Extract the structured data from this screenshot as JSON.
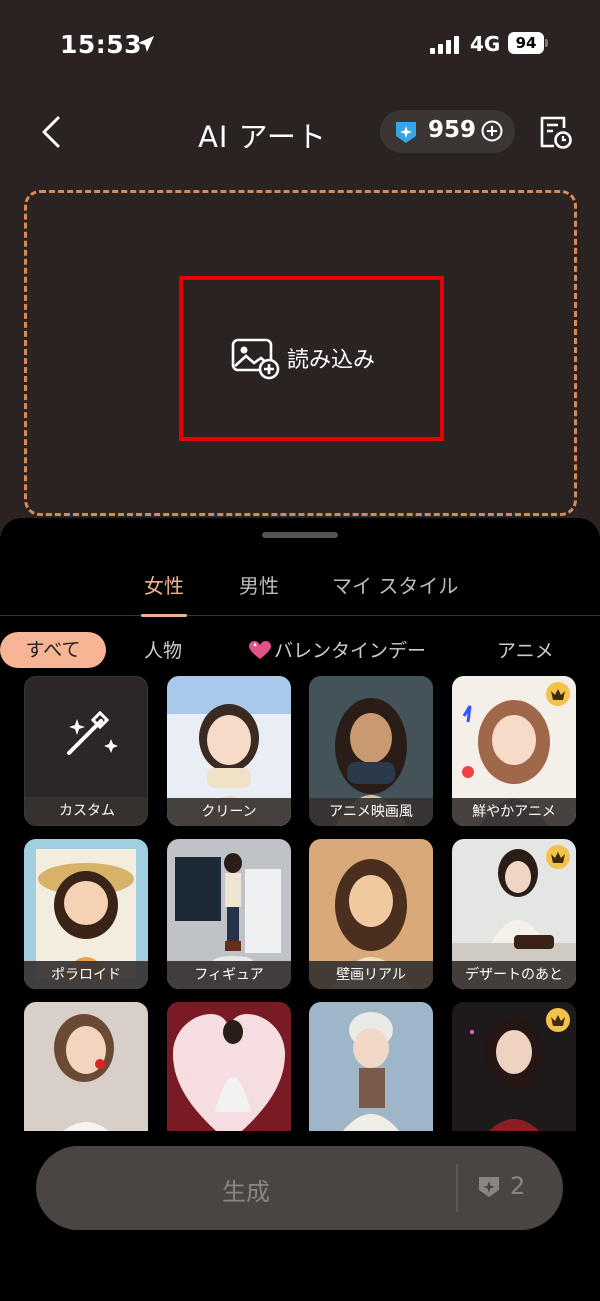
{
  "status": {
    "time": "15:53",
    "network": "4G",
    "battery": "94"
  },
  "header": {
    "title": "AI アート",
    "credits": "959"
  },
  "upload": {
    "import_label": "読み込み"
  },
  "gender_tabs": [
    {
      "label": "女性",
      "active": true
    },
    {
      "label": "男性",
      "active": false
    },
    {
      "label": "マイ スタイル",
      "active": false
    }
  ],
  "categories": [
    {
      "label": "すべて",
      "active": true
    },
    {
      "label": "人物"
    },
    {
      "label": "バレンタインデー"
    },
    {
      "label": "アニメ"
    }
  ],
  "styles": [
    {
      "label": "カスタム",
      "premium": false
    },
    {
      "label": "クリーン",
      "premium": false
    },
    {
      "label": "アニメ映画風",
      "premium": false
    },
    {
      "label": "鮮やかアニメ",
      "premium": true
    },
    {
      "label": "ポラロイド",
      "premium": false
    },
    {
      "label": "フィギュア",
      "premium": false
    },
    {
      "label": "壁画リアル",
      "premium": false
    },
    {
      "label": "デザートのあと",
      "premium": true
    },
    {
      "label": "",
      "premium": false
    },
    {
      "label": "",
      "premium": false
    },
    {
      "label": "",
      "premium": false
    },
    {
      "label": "",
      "premium": true
    }
  ],
  "generate": {
    "label": "生成",
    "cost": "2"
  },
  "colors": {
    "accent": "#f0b18b",
    "pill": "#f7b596",
    "highlight": "#e60000",
    "dash": "#d68a5a"
  }
}
